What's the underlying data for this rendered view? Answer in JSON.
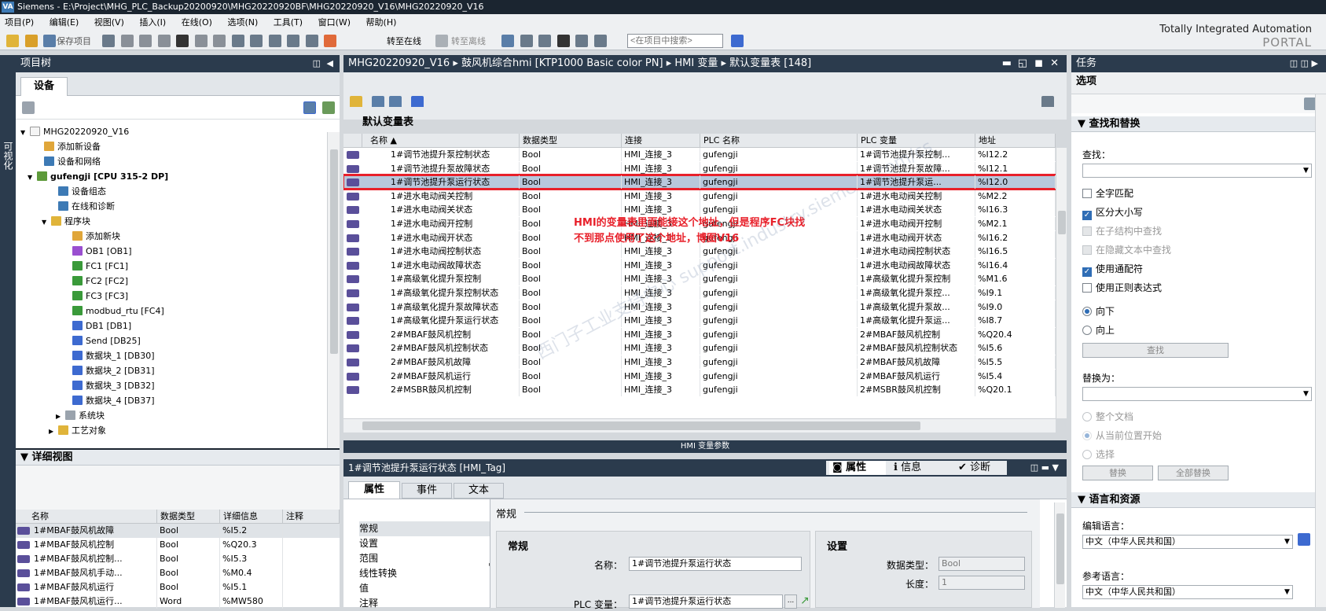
{
  "window": {
    "title": "Siemens  -  E:\\Project\\MHG_PLC_Backup20200920\\MHG20220920BF\\MHG20220920_V16\\MHG20220920_V16",
    "logo": "VA"
  },
  "menu": [
    "项目(P)",
    "编辑(E)",
    "视图(V)",
    "插入(I)",
    "在线(O)",
    "选项(N)",
    "工具(T)",
    "窗口(W)",
    "帮助(H)"
  ],
  "toolbar": {
    "save_project": "保存项目",
    "go_online": "转至在线",
    "go_offline": "转至离线",
    "search_placeholder": "<在项目中搜索>"
  },
  "portal": {
    "line1": "Totally Integrated Automation",
    "line2": "PORTAL"
  },
  "project_tree": {
    "title": "项目树",
    "side_tab": "可视化",
    "devices_tab": "设备",
    "items": [
      {
        "label": "MHG20220920_V16",
        "indent": 0,
        "arrow": "▼",
        "icon": "#f4f4f4"
      },
      {
        "label": "添加新设备",
        "indent": 1,
        "arrow": "",
        "icon": "#e0a63a"
      },
      {
        "label": "设备和网络",
        "indent": 1,
        "arrow": "",
        "icon": "#3d7ab5"
      },
      {
        "label": "gufengji [CPU 315-2 DP]",
        "indent": 0.5,
        "arrow": "▼",
        "icon": "#5d9a3a"
      },
      {
        "label": "设备组态",
        "indent": 2,
        "arrow": "",
        "icon": "#3d7ab5"
      },
      {
        "label": "在线和诊断",
        "indent": 2,
        "arrow": "",
        "icon": "#3d7ab5"
      },
      {
        "label": "程序块",
        "indent": 1.5,
        "arrow": "▼",
        "icon": "#e0b43a"
      },
      {
        "label": "添加新块",
        "indent": 3,
        "arrow": "",
        "icon": "#e0a63a"
      },
      {
        "label": "OB1 [OB1]",
        "indent": 3,
        "arrow": "",
        "icon": "#9a4fd0"
      },
      {
        "label": "FC1 [FC1]",
        "indent": 3,
        "arrow": "",
        "icon": "#3a9a3a"
      },
      {
        "label": "FC2 [FC2]",
        "indent": 3,
        "arrow": "",
        "icon": "#3a9a3a"
      },
      {
        "label": "FC3 [FC3]",
        "indent": 3,
        "arrow": "",
        "icon": "#3a9a3a"
      },
      {
        "label": "modbud_rtu [FC4]",
        "indent": 3,
        "arrow": "",
        "icon": "#3a9a3a"
      },
      {
        "label": "DB1 [DB1]",
        "indent": 3,
        "arrow": "",
        "icon": "#3d6ad0"
      },
      {
        "label": "Send [DB25]",
        "indent": 3,
        "arrow": "",
        "icon": "#3d6ad0"
      },
      {
        "label": "数据块_1 [DB30]",
        "indent": 3,
        "arrow": "",
        "icon": "#3d6ad0"
      },
      {
        "label": "数据块_2 [DB31]",
        "indent": 3,
        "arrow": "",
        "icon": "#3d6ad0"
      },
      {
        "label": "数据块_3 [DB32]",
        "indent": 3,
        "arrow": "",
        "icon": "#3d6ad0"
      },
      {
        "label": "数据块_4 [DB37]",
        "indent": 3,
        "arrow": "",
        "icon": "#3d6ad0"
      },
      {
        "label": "系统块",
        "indent": 2.5,
        "arrow": "▶",
        "icon": "#9aa3ad"
      },
      {
        "label": "工艺对象",
        "indent": 2,
        "arrow": "▶",
        "icon": "#e0b43a"
      }
    ]
  },
  "detail_view": {
    "title": "详细视图",
    "headers": [
      "名称",
      "数据类型",
      "详细信息",
      "注释"
    ],
    "rows": [
      {
        "name": "1#MBAF鼓风机故障",
        "type": "Bool",
        "detail": "%I5.2"
      },
      {
        "name": "1#MBAF鼓风机控制",
        "type": "Bool",
        "detail": "%Q20.3"
      },
      {
        "name": "1#MBAF鼓风机控制...",
        "type": "Bool",
        "detail": "%I5.3"
      },
      {
        "name": "1#MBAF鼓风机手动...",
        "type": "Bool",
        "detail": "%M0.4"
      },
      {
        "name": "1#MBAF鼓风机运行",
        "type": "Bool",
        "detail": "%I5.1"
      },
      {
        "name": "1#MBAF鼓风机运行...",
        "type": "Word",
        "detail": "%MW580"
      }
    ]
  },
  "editor": {
    "breadcrumb": [
      "MHG20220920_V16",
      "鼓风机综合hmi [KTP1000 Basic color PN]",
      "HMI 变量",
      "默认变量表 [148]"
    ],
    "table_title": "默认变量表",
    "headers": [
      "名称 ▲",
      "数据类型",
      "连接",
      "PLC 名称",
      "PLC 变量",
      "地址"
    ],
    "rows": [
      [
        "1#调节池提升泵控制状态",
        "Bool",
        "HMI_连接_3",
        "gufengji",
        "1#调节池提升泵控制...",
        "%I12.2"
      ],
      [
        "1#调节池提升泵故障状态",
        "Bool",
        "HMI_连接_3",
        "gufengji",
        "1#调节池提升泵故障...",
        "%I12.1"
      ],
      [
        "1#调节池提升泵运行状态",
        "Bool",
        "HMI_连接_3",
        "gufengji",
        "1#调节池提升泵运...",
        "%I12.0"
      ],
      [
        "1#进水电动阀关控制",
        "Bool",
        "HMI_连接_3",
        "gufengji",
        "1#进水电动阀关控制",
        "%M2.2"
      ],
      [
        "1#进水电动阀关状态",
        "Bool",
        "HMI_连接_3",
        "gufengji",
        "1#进水电动阀关状态",
        "%I16.3"
      ],
      [
        "1#进水电动阀开控制",
        "Bool",
        "HMI_连接_3",
        "gufengji",
        "1#进水电动阀开控制",
        "%M2.1"
      ],
      [
        "1#进水电动阀开状态",
        "Bool",
        "HMI_连接_3",
        "gufengji",
        "1#进水电动阀开状态",
        "%I16.2"
      ],
      [
        "1#进水电动阀控制状态",
        "Bool",
        "HMI_连接_3",
        "gufengji",
        "1#进水电动阀控制状态",
        "%I16.5"
      ],
      [
        "1#进水电动阀故障状态",
        "Bool",
        "HMI_连接_3",
        "gufengji",
        "1#进水电动阀故障状态",
        "%I16.4"
      ],
      [
        "1#高级氧化提升泵控制",
        "Bool",
        "HMI_连接_3",
        "gufengji",
        "1#高级氧化提升泵控制",
        "%M1.6"
      ],
      [
        "1#高级氧化提升泵控制状态",
        "Bool",
        "HMI_连接_3",
        "gufengji",
        "1#高级氧化提升泵控...",
        "%I9.1"
      ],
      [
        "1#高级氧化提升泵故障状态",
        "Bool",
        "HMI_连接_3",
        "gufengji",
        "1#高级氧化提升泵故...",
        "%I9.0"
      ],
      [
        "1#高级氧化提升泵运行状态",
        "Bool",
        "HMI_连接_3",
        "gufengji",
        "1#高级氧化提升泵运...",
        "%I8.7"
      ],
      [
        "2#MBAF鼓风机控制",
        "Bool",
        "HMI_连接_3",
        "gufengji",
        "2#MBAF鼓风机控制",
        "%Q20.4"
      ],
      [
        "2#MBAF鼓风机控制状态",
        "Bool",
        "HMI_连接_3",
        "gufengji",
        "2#MBAF鼓风机控制状态",
        "%I5.6"
      ],
      [
        "2#MBAF鼓风机故障",
        "Bool",
        "HMI_连接_3",
        "gufengji",
        "2#MBAF鼓风机故障",
        "%I5.5"
      ],
      [
        "2#MBAF鼓风机运行",
        "Bool",
        "HMI_连接_3",
        "gufengji",
        "2#MBAF鼓风机运行",
        "%I5.4"
      ],
      [
        "2#MSBR鼓风机控制",
        "Bool",
        "HMI_连接_3",
        "gufengji",
        "2#MSBR鼓风机控制",
        "%Q20.1"
      ]
    ],
    "annotation_line1": "HMI的变量表里面能接这个地址，但是程序FC块找",
    "annotation_line2": "不到那点使用了这个地址，博图V16",
    "bottom_label": "HMI 变量参数"
  },
  "inspector": {
    "title": "1#调节池提升泵运行状态 [HMI_Tag]",
    "tabs_right": [
      "属性",
      "信息",
      "诊断"
    ],
    "tabs": [
      "属性",
      "事件",
      "文本"
    ],
    "nav": [
      "常规",
      "设置",
      "范围",
      "线性转换",
      "值",
      "注释"
    ],
    "section": "常规",
    "group_general": "常规",
    "group_settings": "设置",
    "name_label": "名称：",
    "name_value": "1#调节池提升泵运行状态",
    "plc_var_label": "PLC 变量：",
    "plc_var_value": "1#调节池提升泵运行状态",
    "data_type_label": "数据类型：",
    "data_type_value": "Bool",
    "length_label": "长度：",
    "length_value": "1"
  },
  "tasks": {
    "title": "任务",
    "options": "选项",
    "find_replace": "查找和替换",
    "find_label": "查找：",
    "checks": [
      {
        "label": "全字匹配",
        "state": "off"
      },
      {
        "label": "区分大小写",
        "state": "on"
      },
      {
        "label": "在子结构中查找",
        "state": "dis"
      },
      {
        "label": "在隐藏文本中查找",
        "state": "dis"
      },
      {
        "label": "使用通配符",
        "state": "on"
      },
      {
        "label": "使用正则表达式",
        "state": "off"
      }
    ],
    "dir_down": "向下",
    "dir_up": "向上",
    "find_button": "查找",
    "replace_label": "替换为：",
    "scope_whole": "整个文档",
    "scope_current": "从当前位置开始",
    "scope_selection": "选择",
    "replace_button": "替换",
    "replace_all_button": "全部替换",
    "lang_section": "语言和资源",
    "edit_lang_label": "编辑语言：",
    "edit_lang_value": "中文（中华人民共和国）",
    "ref_lang_label": "参考语言：",
    "ref_lang_value": "中文（中华人民共和国）"
  },
  "watermark": "西门子工业支持中心 support.industry.siemens.com/cs"
}
